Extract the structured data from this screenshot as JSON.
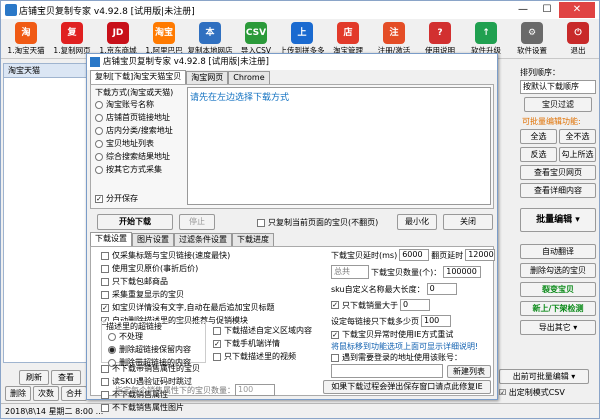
{
  "window": {
    "title": "店铺宝贝复制专家  v4.92.8 [试用版|未注册]",
    "minimize": "—",
    "maximize": "☐",
    "close": "✕"
  },
  "toolbar": [
    {
      "label": "1.淘宝天猫",
      "icon": "淘",
      "color": "#f05a14"
    },
    {
      "label": "1.复制网页",
      "icon": "复",
      "color": "#e02020"
    },
    {
      "label": "1.京东商城",
      "icon": "JD",
      "color": "#c8101a"
    },
    {
      "label": "1.阿里巴巴",
      "icon": "淘宝",
      "color": "#ff7a00"
    },
    {
      "label": "复制本地网店",
      "icon": "本",
      "color": "#3070c0"
    },
    {
      "label": "导入CSV",
      "icon": "CSV",
      "color": "#2b9a3a"
    },
    {
      "label": "上传到拼多多",
      "icon": "上",
      "color": "#1a6ad0"
    },
    {
      "label": "淘宝管理",
      "icon": "店",
      "color": "#e23a2a"
    },
    {
      "label": "注册/激活",
      "icon": "注",
      "color": "#e44d26"
    },
    {
      "label": "使用说明",
      "icon": "?",
      "color": "#d23030"
    },
    {
      "label": "软件升级",
      "icon": "↑",
      "color": "#20a050"
    },
    {
      "label": "软件设置",
      "icon": "⚙",
      "color": "#6a6a6a"
    },
    {
      "label": "退出",
      "icon": "⏻",
      "color": "#c82a2a"
    }
  ],
  "left": {
    "tab": "淘宝天猫"
  },
  "right": {
    "sort_label": "排列顺序：",
    "sort_value": "按默认下载顺序",
    "filter_btn": "宝贝过滤",
    "hint": "可批量编辑功能:",
    "select_all": "全选",
    "deselect_all": "全不选",
    "invert": "反选",
    "select_up": "勾上所选",
    "view_page": "查看宝贝网页",
    "view_detail": "查看详细内容",
    "batch_edit": "批量编辑",
    "auto_translate": "自动翻译",
    "delete_checked": "删除勾选的宝贝",
    "copy_item": "裂变宝贝",
    "new_listing": "新上/下架检测",
    "export": "导出其它",
    "export_batch": "出前可批量编辑",
    "export_csv": "出定制模式CSV"
  },
  "bottom_left": {
    "refresh": "刷新",
    "delete": "删除",
    "merge": "合并",
    "view": "查看",
    "copy": "次数"
  },
  "dialog": {
    "title": "店铺宝贝复制专家  v4.92.8 [试用版|未注册]",
    "tabs": [
      "复制[下载]淘宝天猫宝贝",
      "淘宝网页",
      "Chrome"
    ],
    "method_label": "下载方式(淘宝或天猫)",
    "methods": [
      "淘宝账号名称",
      "店铺首页链接地址",
      "店内分类/搜索地址",
      "宝贝地址列表",
      "综合搜索结果地址",
      "按其它方式采集"
    ],
    "split_save": "分开保存",
    "prompt": "请先在左边选择下载方式",
    "start": "开始下载",
    "stop": "停止",
    "current_only": "只复制当前页面的宝贝(不翻页)",
    "minimize": "最小化",
    "close": "关闭",
    "settings_tabs": [
      "下载设置",
      "图片设置",
      "过滤条件设置",
      "下载进度"
    ],
    "opts": [
      "仅采集标题与宝贝链接(速度最快)",
      "使用宝贝原价(事折后价)",
      "只下载包邮商品",
      "采集重复显示的宝贝",
      "如宝贝详情没有文字,自动在最后追加宝贝标题",
      "自动删除描述里的宝贝推荐与促销模块"
    ],
    "link_group": "描述里的超链接",
    "link_opts": [
      "不处理",
      "删除超链接保留内容",
      "删除带超链接的内容"
    ],
    "img_opts": [
      "下载描述自定义区域内容",
      "下载手机端详情",
      "只下载描述里的视频"
    ],
    "opts2": [
      "不下载带销售属性的宝贝",
      "读SKU遇验证码时跳过",
      "不下载销售属性",
      "不下载销售属性图片"
    ],
    "specify_count": "指定每个销售属性下的宝贝数量：",
    "specify_value": "100",
    "delay_label": "下载宝贝延时(ms)",
    "delay_value": "6000",
    "page_delay_label": "翻页延时",
    "page_delay_value": "12000",
    "total_label": "总共",
    "count_label": "下载宝贝数量(个)：",
    "count_value": "100000",
    "sku_label": "sku自定义名称最大长度：",
    "sku_value": "0",
    "sales_label": "只下载销量大于",
    "sales_value": "0",
    "max_page_label": "设定每链接只下载多少页",
    "max_page_value": "100",
    "ie_fail": "下载宝贝异常时使用IE方式重试",
    "warn": "将鼠标移到功能选项上面可显示详细说明!",
    "captcha": "遇到需要登录的地址使用该账号：",
    "new_list": "新建列表",
    "ie_popup": "如果下载过程会弹出保存窗口请点此修复IE"
  },
  "status": "2018\\8\\14 星期二 8:00 ..."
}
